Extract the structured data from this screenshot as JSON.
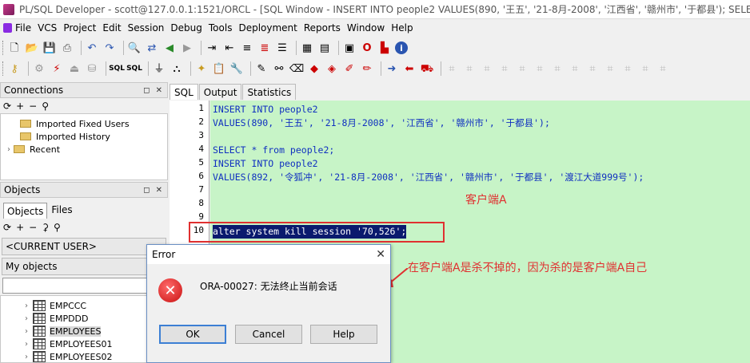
{
  "window": {
    "title": "PL/SQL Developer - scott@127.0.0.1:1521/ORCL - [SQL Window - INSERT INTO people2 VALUES(890, '王五', '21-8月-2008', '江西省', '赣州市', '于都县'); SELECT * from"
  },
  "menu": [
    "File",
    "VCS",
    "Project",
    "Edit",
    "Session",
    "Debug",
    "Tools",
    "Deployment",
    "Reports",
    "Window",
    "Help"
  ],
  "toolbar1": [
    "new-icon",
    "open-icon",
    "save-icon",
    "print-icon",
    "undo-icon",
    "redo-icon",
    "find-icon",
    "replace-icon",
    "navigate-back-icon",
    "navigate-forward-icon",
    "indent-icon",
    "unindent-icon",
    "uppercase-icon",
    "lowercase-icon",
    "comment-icon",
    "uncomment-icon",
    "window-list-icon",
    "close-window-icon",
    "pdf-icon",
    "info-icon"
  ],
  "toolbar2": [
    "key-icon",
    "gear-icon",
    "execute-icon",
    "break-icon",
    "commit-icon",
    "rollback-icon",
    "sql-icon",
    "sql-alt-icon",
    "wrench-icon",
    "debug-icon",
    "arrow-right-icon",
    "arrow-left-icon",
    "truck-icon"
  ],
  "connections": {
    "header": "Connections",
    "items": [
      "Imported Fixed Users",
      "Imported History",
      "Recent"
    ]
  },
  "objects": {
    "header": "Objects",
    "tabs": [
      "Objects",
      "Files"
    ],
    "current_user": "<CURRENT USER>",
    "my_objects": "My objects",
    "filter_value": "",
    "items": [
      "EMPCCC",
      "EMPDDD",
      "EMPLOYEES",
      "EMPLOYEES01",
      "EMPLOYEES02"
    ],
    "selected": "EMPLOYEES"
  },
  "editor": {
    "tabs": [
      "SQL",
      "Output",
      "Statistics"
    ],
    "active_tab": "SQL",
    "lines": [
      {
        "n": "1",
        "text": "INSERT INTO people2"
      },
      {
        "n": "2",
        "text": "VALUES(890, '王五', '21-8月-2008', '江西省', '赣州市', '于都县');"
      },
      {
        "n": "3",
        "text": ""
      },
      {
        "n": "4",
        "text": "SELECT * from people2;"
      },
      {
        "n": "5",
        "text": "INSERT INTO people2"
      },
      {
        "n": "6",
        "text": "VALUES(892, '令狐冲', '21-8月-2008', '江西省', '赣州市', '于都县', '渡江大道999号');"
      },
      {
        "n": "7",
        "text": ""
      },
      {
        "n": "8",
        "text": ""
      },
      {
        "n": "9",
        "text": ""
      },
      {
        "n": "10",
        "text": "alter system kill session '70,526';"
      }
    ]
  },
  "annotations": {
    "client_label": "客户端A",
    "note": "在客户端A是杀不掉的，因为杀的是客户端A自己",
    "color": "#e03030"
  },
  "dialog": {
    "title": "Error",
    "message": "ORA-00027: 无法终止当前会话",
    "buttons": [
      "OK",
      "Cancel",
      "Help"
    ]
  },
  "colors": {
    "editor_bg": "#c7f4c7",
    "code_text": "#1030c0",
    "selection": "#0a1a6e"
  }
}
